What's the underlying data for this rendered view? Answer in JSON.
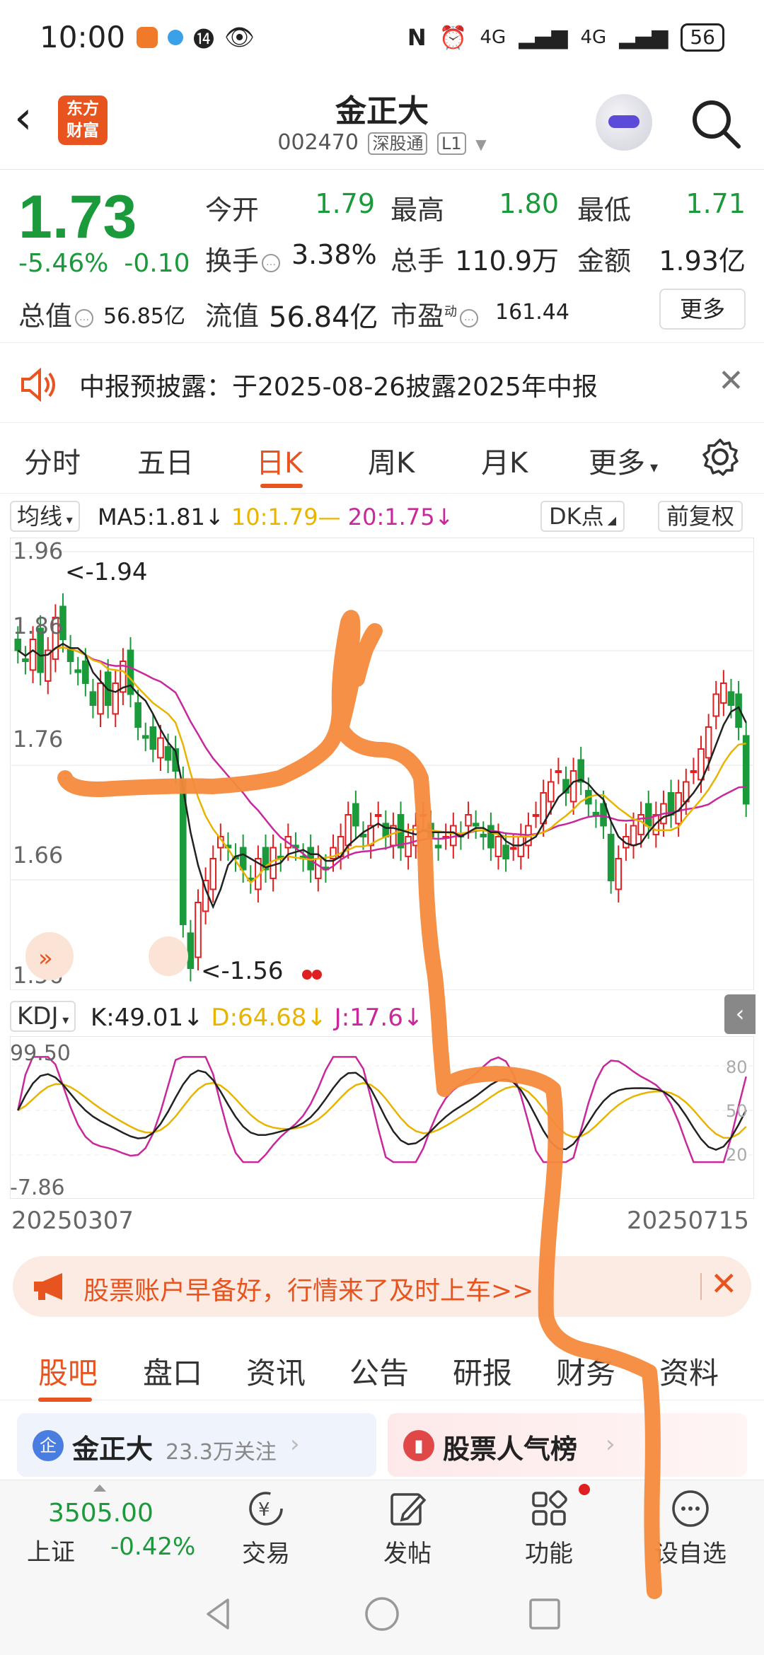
{
  "status": {
    "time": "10:00",
    "battery": "56",
    "net1": "4G",
    "net2": "4G"
  },
  "header": {
    "logo_line1": "东方",
    "logo_line2": "财富",
    "stock_name": "金正大",
    "stock_code": "002470",
    "tag_connect": "深股通",
    "tag_level": "L1"
  },
  "quote": {
    "price": "1.73",
    "change_pct": "-5.46%",
    "change_abs": "-0.10",
    "open_label": "今开",
    "open_value": "1.79",
    "high_label": "最高",
    "high_value": "1.80",
    "low_label": "最低",
    "low_value": "1.71",
    "turnover_label": "换手",
    "turnover_value": "3.38%",
    "volume_label": "总手",
    "volume_value": "110.9万",
    "amount_label": "金额",
    "amount_value": "1.93亿",
    "mktcap_label": "总值",
    "mktcap_value": "56.85亿",
    "float_label": "流值",
    "float_value": "56.84亿",
    "pe_label": "市盈",
    "pe_sup": "动",
    "pe_value": "161.44",
    "more_label": "更多"
  },
  "notice": {
    "text": "中报预披露：于2025-08-26披露2025年中报"
  },
  "periods": {
    "tabs": [
      "分时",
      "五日",
      "日K",
      "周K",
      "月K"
    ],
    "more": "更多",
    "active_index": 2
  },
  "ma": {
    "button": "均线",
    "ma5": "MA5:1.81",
    "ma10": "10:1.79",
    "ma20": "20:1.75",
    "dk_button": "DK点",
    "fq_button": "前复权"
  },
  "chart_labels": {
    "y_ticks": [
      "1.96",
      "1.86",
      "1.76",
      "1.66",
      "1.56"
    ],
    "high_mark": "<-1.94",
    "low_mark": "<-1.56"
  },
  "kdj": {
    "button": "KDJ",
    "k": "K:49.01",
    "d": "D:64.68",
    "j": "J:17.6",
    "y_top": "99.50",
    "y_bottom": "-7.86",
    "r80": "80",
    "r50": "50",
    "r20": "20"
  },
  "dates": {
    "start": "20250307",
    "end": "20250715"
  },
  "banner": {
    "text": "股票账户早备好，行情来了及时上车>>"
  },
  "section_tabs": [
    "股吧",
    "盘口",
    "资讯",
    "公告",
    "研报",
    "财务",
    "资料"
  ],
  "cards": {
    "c1_icon": "企",
    "c1_title": "金正大",
    "c1_sub": "23.3万关注",
    "c2_title": "股票人气榜"
  },
  "bottom": {
    "index_value": "3505.00",
    "index_name": "上证",
    "index_change": "-0.42%",
    "nav": [
      "交易",
      "发帖",
      "功能",
      "设自选"
    ]
  },
  "colors": {
    "up": "#e02020",
    "down": "#1a9a3a",
    "ma5": "#222222",
    "ma10": "#e8b400",
    "ma20": "#c8289b",
    "accent": "#e85420",
    "stroke": "#f58a3c"
  }
}
